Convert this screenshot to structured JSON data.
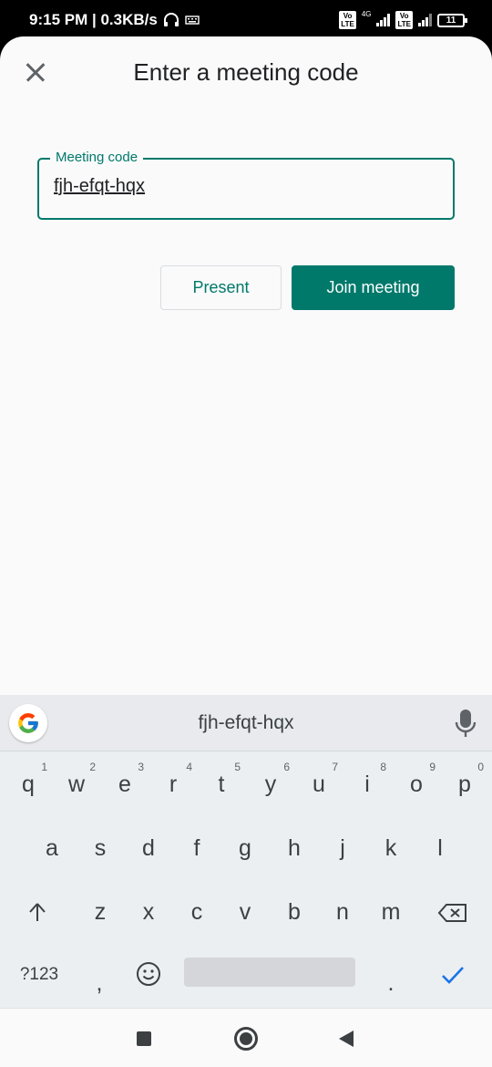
{
  "status_bar": {
    "time_speed": "9:15 PM | 0.3KB/s",
    "network_label": "4G",
    "volte_label": "Vo\nLTE",
    "battery": "11"
  },
  "dialog": {
    "title": "Enter a meeting code",
    "field_label": "Meeting code",
    "field_value": "fjh-efqt-hqx",
    "present_label": "Present",
    "join_label": "Join meeting"
  },
  "keyboard": {
    "suggestion": "fjh-efqt-hqx",
    "row1": [
      {
        "k": "q",
        "h": "1"
      },
      {
        "k": "w",
        "h": "2"
      },
      {
        "k": "e",
        "h": "3"
      },
      {
        "k": "r",
        "h": "4"
      },
      {
        "k": "t",
        "h": "5"
      },
      {
        "k": "y",
        "h": "6"
      },
      {
        "k": "u",
        "h": "7"
      },
      {
        "k": "i",
        "h": "8"
      },
      {
        "k": "o",
        "h": "9"
      },
      {
        "k": "p",
        "h": "0"
      }
    ],
    "row2": [
      "a",
      "s",
      "d",
      "f",
      "g",
      "h",
      "j",
      "k",
      "l"
    ],
    "row3": [
      "z",
      "x",
      "c",
      "v",
      "b",
      "n",
      "m"
    ],
    "symbols_label": "?123",
    "comma": ",",
    "period": ".",
    "accent_color": "#1a73e8"
  },
  "colors": {
    "brand": "#00796b",
    "sheet_bg": "#fafafa",
    "keyboard_bg": "#eceff1"
  }
}
